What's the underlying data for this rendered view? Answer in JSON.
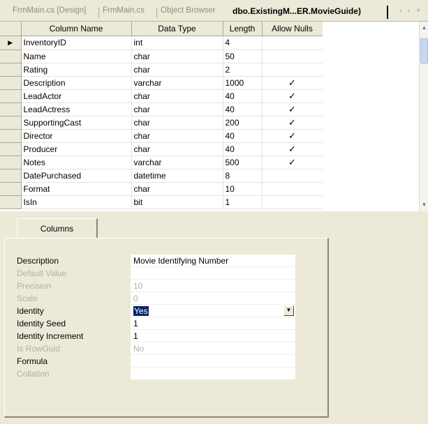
{
  "tabs": [
    {
      "label": "FrmMain.cs [Design]",
      "active": false
    },
    {
      "label": "FrmMain.cs",
      "active": false
    },
    {
      "label": "Object Browser",
      "active": false
    },
    {
      "label": "dbo.ExistingM...ER.MovieGuide)",
      "active": true
    }
  ],
  "nav_icons": "‹ › ×",
  "grid": {
    "headers": [
      "Column Name",
      "Data Type",
      "Length",
      "Allow Nulls"
    ],
    "rows": [
      {
        "name": "InventoryID",
        "type": "int",
        "length": "4",
        "nulls": "",
        "current": true
      },
      {
        "name": "Name",
        "type": "char",
        "length": "50",
        "nulls": ""
      },
      {
        "name": "Rating",
        "type": "char",
        "length": "2",
        "nulls": ""
      },
      {
        "name": "Description",
        "type": "varchar",
        "length": "1000",
        "nulls": "✓"
      },
      {
        "name": "LeadActor",
        "type": "char",
        "length": "40",
        "nulls": "✓"
      },
      {
        "name": "LeadActress",
        "type": "char",
        "length": "40",
        "nulls": "✓"
      },
      {
        "name": "SupportingCast",
        "type": "char",
        "length": "200",
        "nulls": "✓"
      },
      {
        "name": "Director",
        "type": "char",
        "length": "40",
        "nulls": "✓"
      },
      {
        "name": "Producer",
        "type": "char",
        "length": "40",
        "nulls": "✓"
      },
      {
        "name": "Notes",
        "type": "varchar",
        "length": "500",
        "nulls": "✓"
      },
      {
        "name": "DatePurchased",
        "type": "datetime",
        "length": "8",
        "nulls": ""
      },
      {
        "name": "Format",
        "type": "char",
        "length": "10",
        "nulls": ""
      },
      {
        "name": "IsIn",
        "type": "bit",
        "length": "1",
        "nulls": ""
      }
    ],
    "row_marker": "▶"
  },
  "properties": {
    "tab_label": "Columns",
    "items": [
      {
        "label": "Description",
        "value": "Movie Identifying Number",
        "enabled": true
      },
      {
        "label": "Default Value",
        "value": "",
        "enabled": false
      },
      {
        "label": "Precision",
        "value": "10",
        "enabled": false
      },
      {
        "label": "Scale",
        "value": "0",
        "enabled": false
      },
      {
        "label": "Identity",
        "value": "Yes",
        "enabled": true,
        "dropdown": true
      },
      {
        "label": "Identity Seed",
        "value": "1",
        "enabled": true
      },
      {
        "label": "Identity Increment",
        "value": "1",
        "enabled": true
      },
      {
        "label": "Is RowGuid",
        "value": "No",
        "enabled": false
      },
      {
        "label": "Formula",
        "value": "",
        "enabled": true
      },
      {
        "label": "Collation",
        "value": "",
        "enabled": false
      }
    ],
    "dropdown_glyph": "▼"
  }
}
